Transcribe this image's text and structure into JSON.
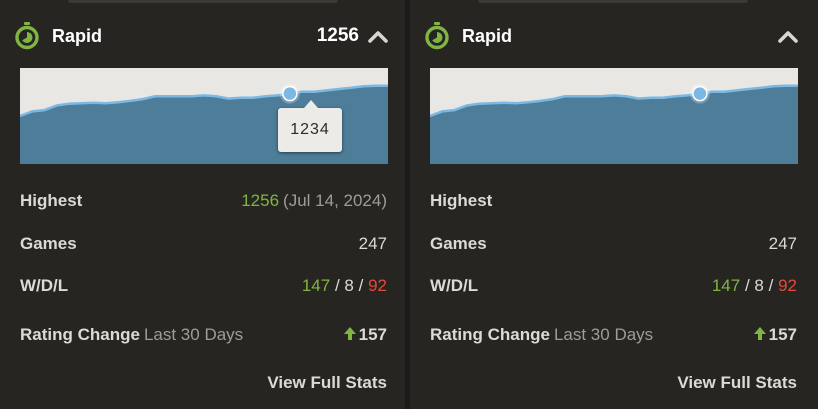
{
  "colors": {
    "background": "#262522",
    "chart_fill": "#4d7d98",
    "chart_line": "#7bb8e3",
    "marker": "#7bb8e3",
    "green": "#80b544",
    "red": "#e6493a"
  },
  "panels": [
    {
      "title": "Rapid",
      "rating": "1256",
      "tooltip": "1234",
      "highest_label": "Highest",
      "highest_value": "1256",
      "highest_date": "(Jul 14, 2024)",
      "games_label": "Games",
      "games_value": "247",
      "wdl_label": "W/D/L",
      "wins": "147",
      "draws": "8",
      "losses": "92",
      "sep": "/",
      "change_label": "Rating Change",
      "change_period": "Last 30 Days",
      "change_value": "157",
      "full_stats": "View Full Stats"
    },
    {
      "title": "Rapid",
      "rating": "",
      "highest_label": "Highest",
      "highest_value": "",
      "highest_date": "",
      "games_label": "Games",
      "games_value": "247",
      "wdl_label": "W/D/L",
      "wins": "147",
      "draws": "8",
      "losses": "92",
      "sep": "/",
      "change_label": "Rating Change",
      "change_period": "Last 30 Days",
      "change_value": "157",
      "full_stats": "View Full Stats"
    }
  ],
  "chart_data": {
    "type": "area",
    "title": "",
    "xlabel": "",
    "ylabel": "",
    "ylim": [
      1080,
      1290
    ],
    "x": [
      0,
      1,
      2,
      3,
      4,
      5,
      6,
      7,
      8,
      9,
      10,
      11,
      12,
      13,
      14,
      15,
      16,
      17,
      18,
      19,
      20,
      21,
      22,
      23,
      24,
      25,
      26,
      27,
      28,
      29,
      30
    ],
    "values": [
      1185,
      1195,
      1198,
      1208,
      1212,
      1213,
      1214,
      1213,
      1215,
      1218,
      1222,
      1228,
      1228,
      1228,
      1228,
      1230,
      1228,
      1223,
      1225,
      1225,
      1228,
      1230,
      1234,
      1238,
      1238,
      1241,
      1244,
      1247,
      1250,
      1251,
      1251
    ],
    "highlight_index": 22,
    "highlight_value": 1234
  }
}
